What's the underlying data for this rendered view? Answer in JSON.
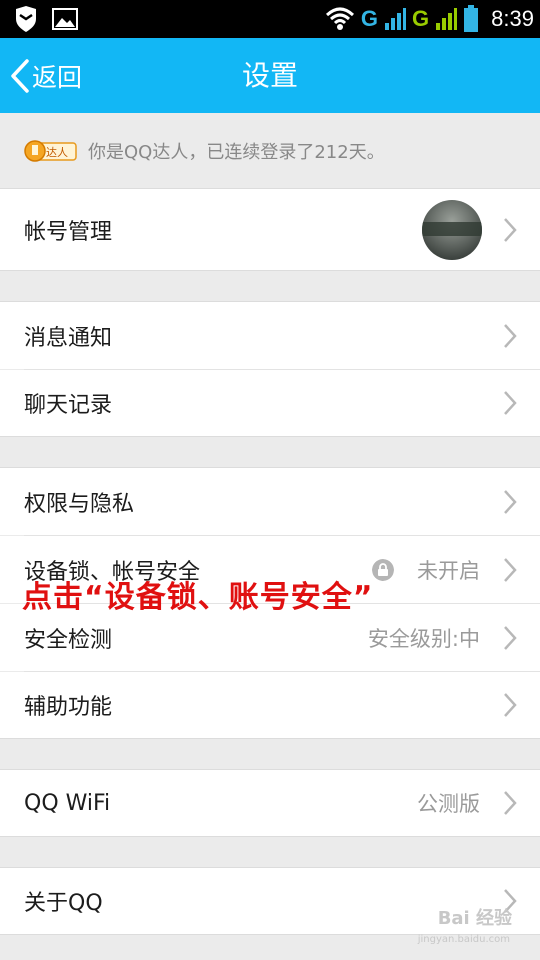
{
  "status_bar": {
    "time": "8:39",
    "network_1": "G",
    "network_2": "G",
    "icons": [
      "shield-icon",
      "image-icon",
      "wifi-icon",
      "signal-icon",
      "battery-icon"
    ]
  },
  "header": {
    "back_label": "返回",
    "title": "设置"
  },
  "notice": {
    "badge_text": "达人",
    "text": "你是QQ达人，已连续登录了212天。"
  },
  "settings": {
    "account": {
      "label": "帐号管理"
    },
    "notifications": {
      "label": "消息通知"
    },
    "chat_history": {
      "label": "聊天记录"
    },
    "privacy": {
      "label": "权限与隐私"
    },
    "device_lock": {
      "label": "设备锁、帐号安全",
      "value": "未开启"
    },
    "security_check": {
      "label": "安全检测",
      "value": "安全级别:中"
    },
    "accessibility": {
      "label": "辅助功能"
    },
    "qq_wifi": {
      "label": "QQ WiFi",
      "value": "公测版"
    },
    "about": {
      "label": "关于QQ"
    }
  },
  "annotation": {
    "text": "点击“设备锁、账号安全”"
  },
  "watermark": {
    "text": "Bai 经验",
    "sub": "jingyan.baidu.com"
  },
  "colors": {
    "title_bar": "#12b7f5",
    "background": "#ebebeb",
    "annotation": "#e01010"
  }
}
